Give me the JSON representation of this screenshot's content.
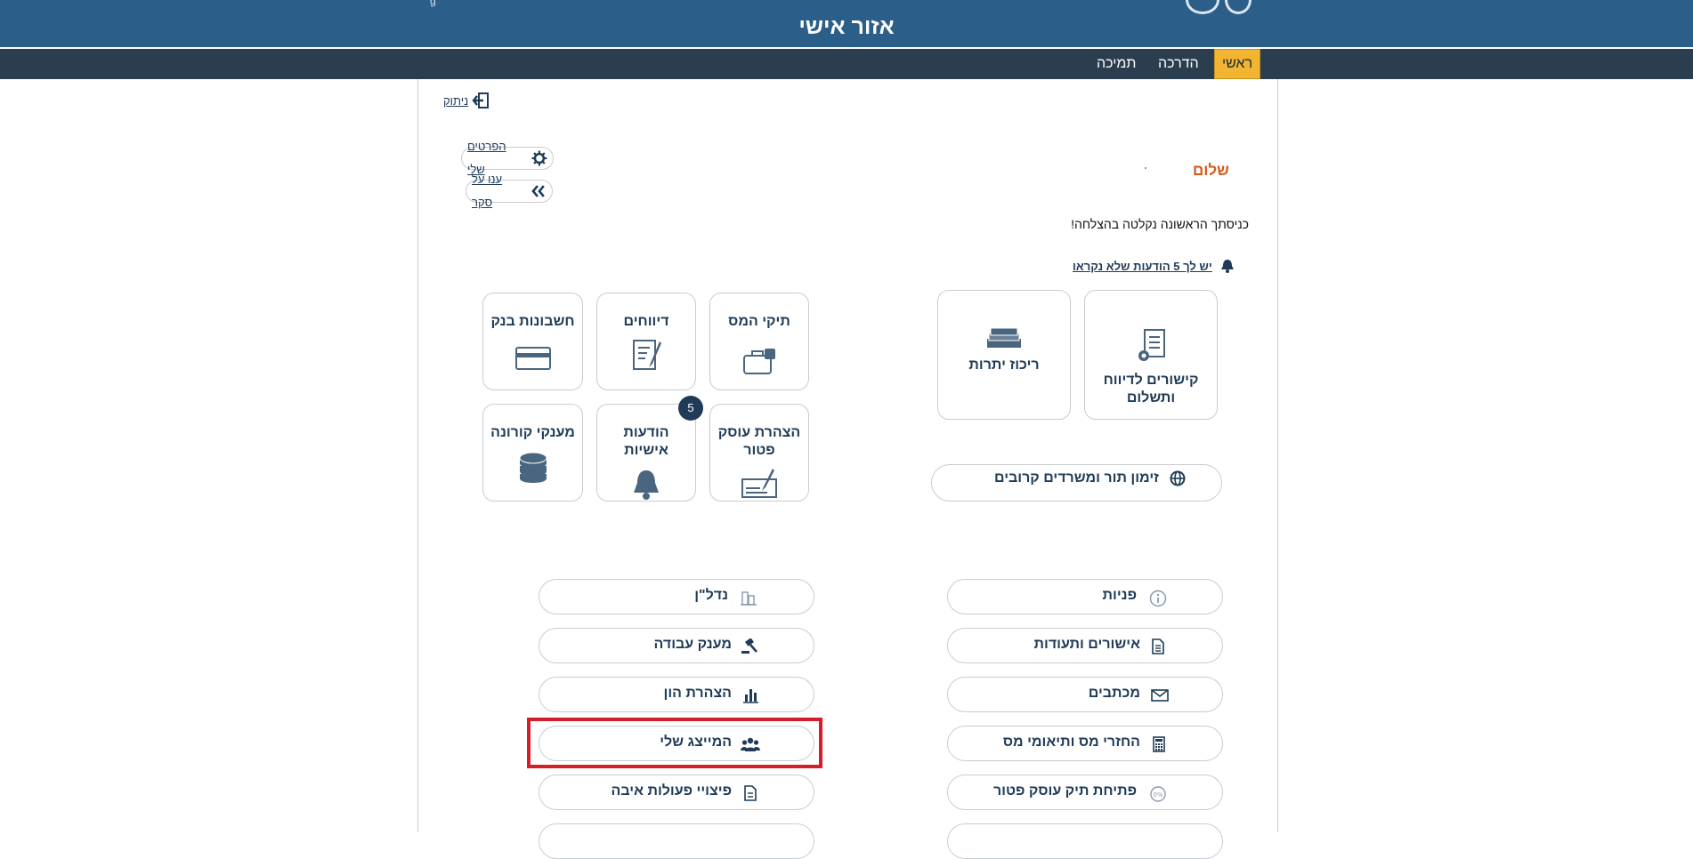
{
  "header": {
    "title": "אזור אישי"
  },
  "nav": {
    "items": [
      "ראשי",
      "הדרכה",
      "תמיכה"
    ]
  },
  "account": {
    "logout": "ניתוק",
    "my_details": "הפרטים שלי",
    "survey": "ענו על סקר"
  },
  "welcome": {
    "greeting": "שלום",
    "login_message": "כניסתך הראשונה נקלטה בהצלחה!",
    "unread_link": "יש לך 5 הודעות שלא נקראו"
  },
  "tiles": {
    "tax_files": "תיקי המס",
    "reports": "דיווחים",
    "bank_accounts": "חשבונות בנק",
    "exempt_declaration": "הצהרת עוסק פטור",
    "personal_messages": "הודעות אישיות",
    "corona_grants": "מענקי קורונה",
    "messages_badge": "5",
    "reporting_links": "קישורים לדיווח ותשלום",
    "balances": "ריכוז יתרות",
    "appointments": "זימון תור ומשרדים קרובים"
  },
  "links": {
    "right": [
      "פניות",
      "אישורים ותעודות",
      "מכתבים",
      "החזרי מס ותיאומי מס",
      "פתיחת תיק עוסק פטור"
    ],
    "left": [
      "נדל\"ן",
      "מענק עבודה",
      "הצהרת הון",
      "המייצג שלי",
      "פיצויי פעולות איבה"
    ]
  }
}
